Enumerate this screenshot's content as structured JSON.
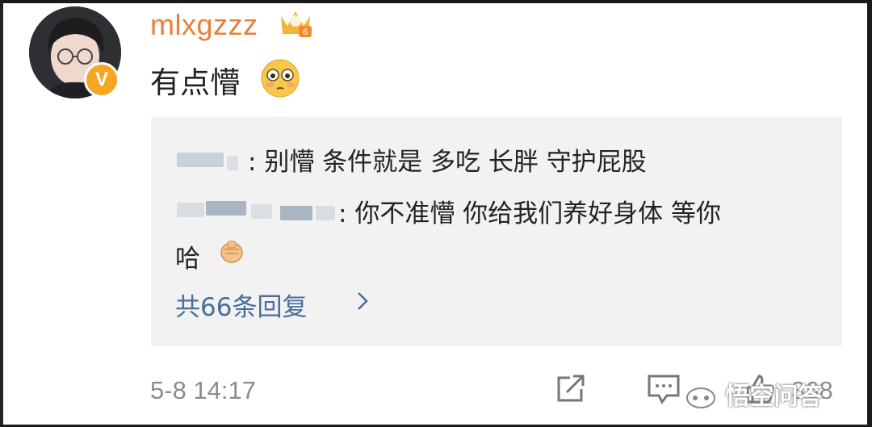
{
  "post": {
    "username": "mlxgzzz",
    "text": "有点懵",
    "verified_badge": "V",
    "crown_icon": "crown-level-icon",
    "emoji": "flushed-face-icon"
  },
  "replies": {
    "items": [
      {
        "author_suffix": ": ",
        "text": "别懵 条件就是 多吃 长胖 守护屁股"
      },
      {
        "author_suffix": ": ",
        "text": "你不准懵 你给我们养好身体 等你"
      },
      {
        "text_cont": "哈"
      }
    ],
    "more_label": "共66条回复"
  },
  "footer": {
    "timestamp": "5-8 14:17",
    "like_count": "368",
    "share_icon": "share-icon",
    "comment_icon": "comment-icon",
    "like_icon": "thumbs-up-icon"
  },
  "watermark": "悟空问答",
  "colors": {
    "username": "#e8803a",
    "link": "#4a6e99",
    "reply_bg": "#f2f2f2",
    "meta": "#8c8c8c",
    "badge": "#f6a623"
  }
}
